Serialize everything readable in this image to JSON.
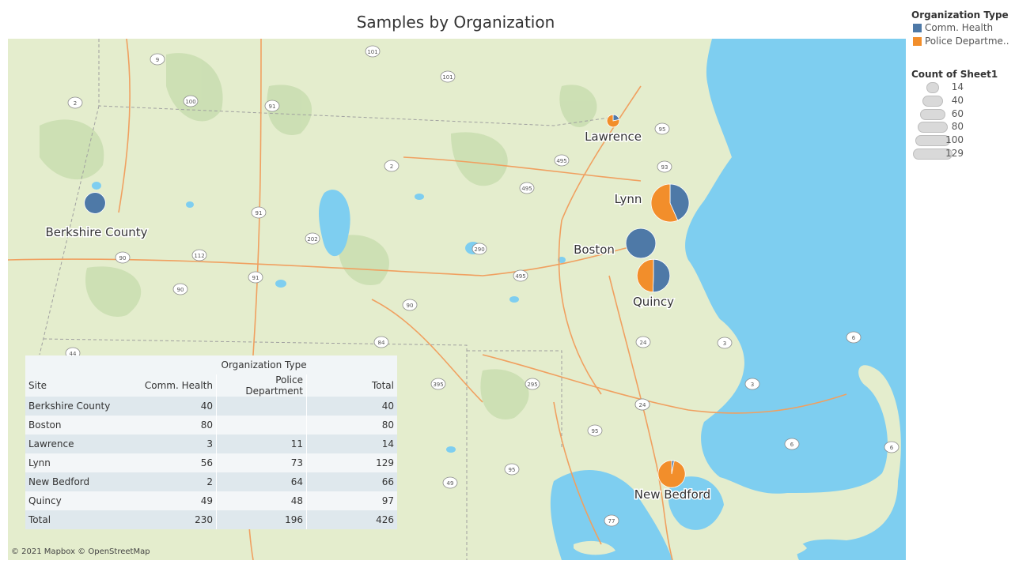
{
  "title": "Samples by Organization",
  "attribution": "© 2021 Mapbox © OpenStreetMap",
  "colors": {
    "comm_health": "#4e79a7",
    "police": "#f28e2b",
    "water": "#7ecef0",
    "land": "#e4edcd"
  },
  "legend_color": {
    "title": "Organization Type",
    "items": [
      {
        "label": "Comm. Health",
        "color": "#4e79a7"
      },
      {
        "label": "Police Departme..",
        "color": "#f28e2b"
      }
    ]
  },
  "legend_size": {
    "title": "Count of Sheet1",
    "values": [
      "14",
      "40",
      "60",
      "80",
      "100",
      "129"
    ]
  },
  "sites": [
    {
      "name": "Berkshire County",
      "comm_health": 40,
      "police": 0,
      "total": 40
    },
    {
      "name": "Boston",
      "comm_health": 80,
      "police": 0,
      "total": 80
    },
    {
      "name": "Lawrence",
      "comm_health": 3,
      "police": 11,
      "total": 14
    },
    {
      "name": "Lynn",
      "comm_health": 56,
      "police": 73,
      "total": 129
    },
    {
      "name": "New Bedford",
      "comm_health": 2,
      "police": 64,
      "total": 66
    },
    {
      "name": "Quincy",
      "comm_health": 49,
      "police": 48,
      "total": 97
    }
  ],
  "road_shields": [
    "9",
    "101",
    "101",
    "2",
    "100",
    "91",
    "95",
    "93",
    "2",
    "495",
    "495",
    "91",
    "202",
    "112",
    "90",
    "290",
    "91",
    "495",
    "90",
    "90",
    "84",
    "44",
    "84",
    "395",
    "295",
    "95",
    "195",
    "24",
    "3",
    "24",
    "3",
    "6",
    "6",
    "6",
    "49",
    "95",
    "77"
  ],
  "table": {
    "group_header": "Organization Type",
    "columns": [
      "Site",
      "Comm. Health",
      "Police Department",
      "Total"
    ],
    "rows": [
      [
        "Berkshire County",
        "40",
        "",
        "40"
      ],
      [
        "Boston",
        "80",
        "",
        "80"
      ],
      [
        "Lawrence",
        "3",
        "11",
        "14"
      ],
      [
        "Lynn",
        "56",
        "73",
        "129"
      ],
      [
        "New Bedford",
        "2",
        "64",
        "66"
      ],
      [
        "Quincy",
        "49",
        "48",
        "97"
      ],
      [
        "Total",
        "230",
        "196",
        "426"
      ]
    ]
  }
}
